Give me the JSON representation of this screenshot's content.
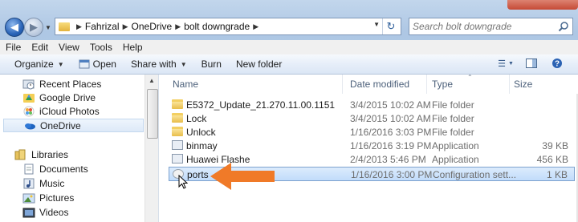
{
  "address": {
    "crumbs": [
      "Fahrizal",
      "OneDrive",
      "bolt downgrade"
    ]
  },
  "search": {
    "placeholder": "Search bolt downgrade"
  },
  "menu": [
    "File",
    "Edit",
    "View",
    "Tools",
    "Help"
  ],
  "commands": {
    "organize": "Organize",
    "open": "Open",
    "share_with": "Share with",
    "burn": "Burn",
    "new_folder": "New folder"
  },
  "nav": {
    "items": [
      {
        "label": "Recent Places",
        "icon": "recent-places-icon"
      },
      {
        "label": "Google Drive",
        "icon": "google-drive-icon"
      },
      {
        "label": "iCloud Photos",
        "icon": "icloud-photos-icon"
      },
      {
        "label": "OneDrive",
        "icon": "onedrive-icon",
        "selected": true
      }
    ],
    "libraries": {
      "label": "Libraries",
      "items": [
        {
          "label": "Documents",
          "icon": "documents-icon"
        },
        {
          "label": "Music",
          "icon": "music-icon"
        },
        {
          "label": "Pictures",
          "icon": "pictures-icon"
        },
        {
          "label": "Videos",
          "icon": "videos-icon"
        }
      ]
    }
  },
  "columns": {
    "name": "Name",
    "date": "Date modified",
    "type": "Type",
    "size": "Size"
  },
  "files": [
    {
      "name": "E5372_Update_21.270.11.00.1151",
      "date": "3/4/2015 10:02 AM",
      "type": "File folder",
      "size": "",
      "icon": "folder-icon"
    },
    {
      "name": "Lock",
      "date": "3/4/2015 10:02 AM",
      "type": "File folder",
      "size": "",
      "icon": "folder-icon"
    },
    {
      "name": "Unlock",
      "date": "1/16/2016 3:03 PM",
      "type": "File folder",
      "size": "",
      "icon": "folder-icon"
    },
    {
      "name": "binmay",
      "date": "1/16/2016 3:19 PM",
      "type": "Application",
      "size": "39 KB",
      "icon": "application-icon"
    },
    {
      "name": "Huawei Flashe",
      "date": "2/4/2013 5:46 PM",
      "type": "Application",
      "size": "456 KB",
      "icon": "application-icon"
    },
    {
      "name": "ports",
      "date": "1/16/2016 3:00 PM",
      "type": "Configuration sett...",
      "size": "1 KB",
      "icon": "configuration-file-icon",
      "selected": true
    }
  ],
  "colors": {
    "accent_arrow": "#f07a28",
    "selection": "#c1dcfb"
  }
}
